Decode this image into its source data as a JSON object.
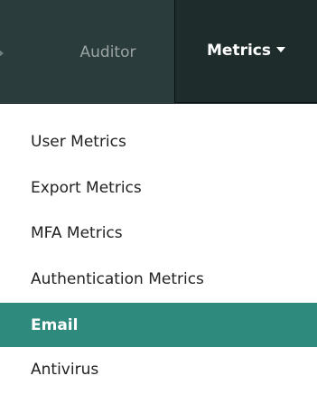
{
  "colors": {
    "navbar_bg": "#2a3c3b",
    "active_nav_bg": "#1e2d2c",
    "active_item_bg": "#2f8a7e",
    "nav_inactive_text": "#9aa4a3",
    "nav_active_text": "#ffffff",
    "menu_text": "#222222"
  },
  "nav": {
    "left_arrow_icon": "caret-left-icon",
    "items": [
      {
        "label": "Auditor",
        "active": false
      },
      {
        "label": "Metrics",
        "active": true,
        "icon": "caret-down-icon"
      }
    ]
  },
  "dropdown": {
    "items": [
      {
        "label": "User Metrics",
        "active": false
      },
      {
        "label": "Export Metrics",
        "active": false
      },
      {
        "label": "MFA Metrics",
        "active": false
      },
      {
        "label": "Authentication Metrics",
        "active": false
      },
      {
        "label": "Email",
        "active": true
      },
      {
        "label": "Antivirus",
        "active": false
      }
    ]
  }
}
